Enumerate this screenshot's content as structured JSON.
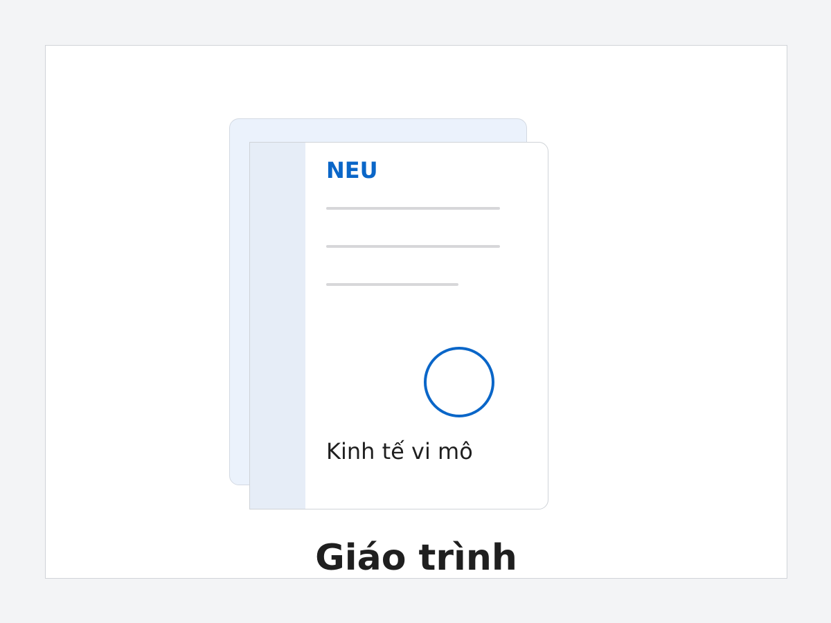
{
  "book": {
    "brand": "NEU",
    "subject": "Kinh tế vi mô",
    "emblem_icon": "circle-emblem-icon"
  },
  "caption": "Giáo trình",
  "colors": {
    "accent": "#0a66c8",
    "page_back": "#ebf2fc",
    "spine": "#e6edf7",
    "rule": "#d7d7d9",
    "text": "#1f1f1f",
    "background": "#f3f4f6"
  }
}
